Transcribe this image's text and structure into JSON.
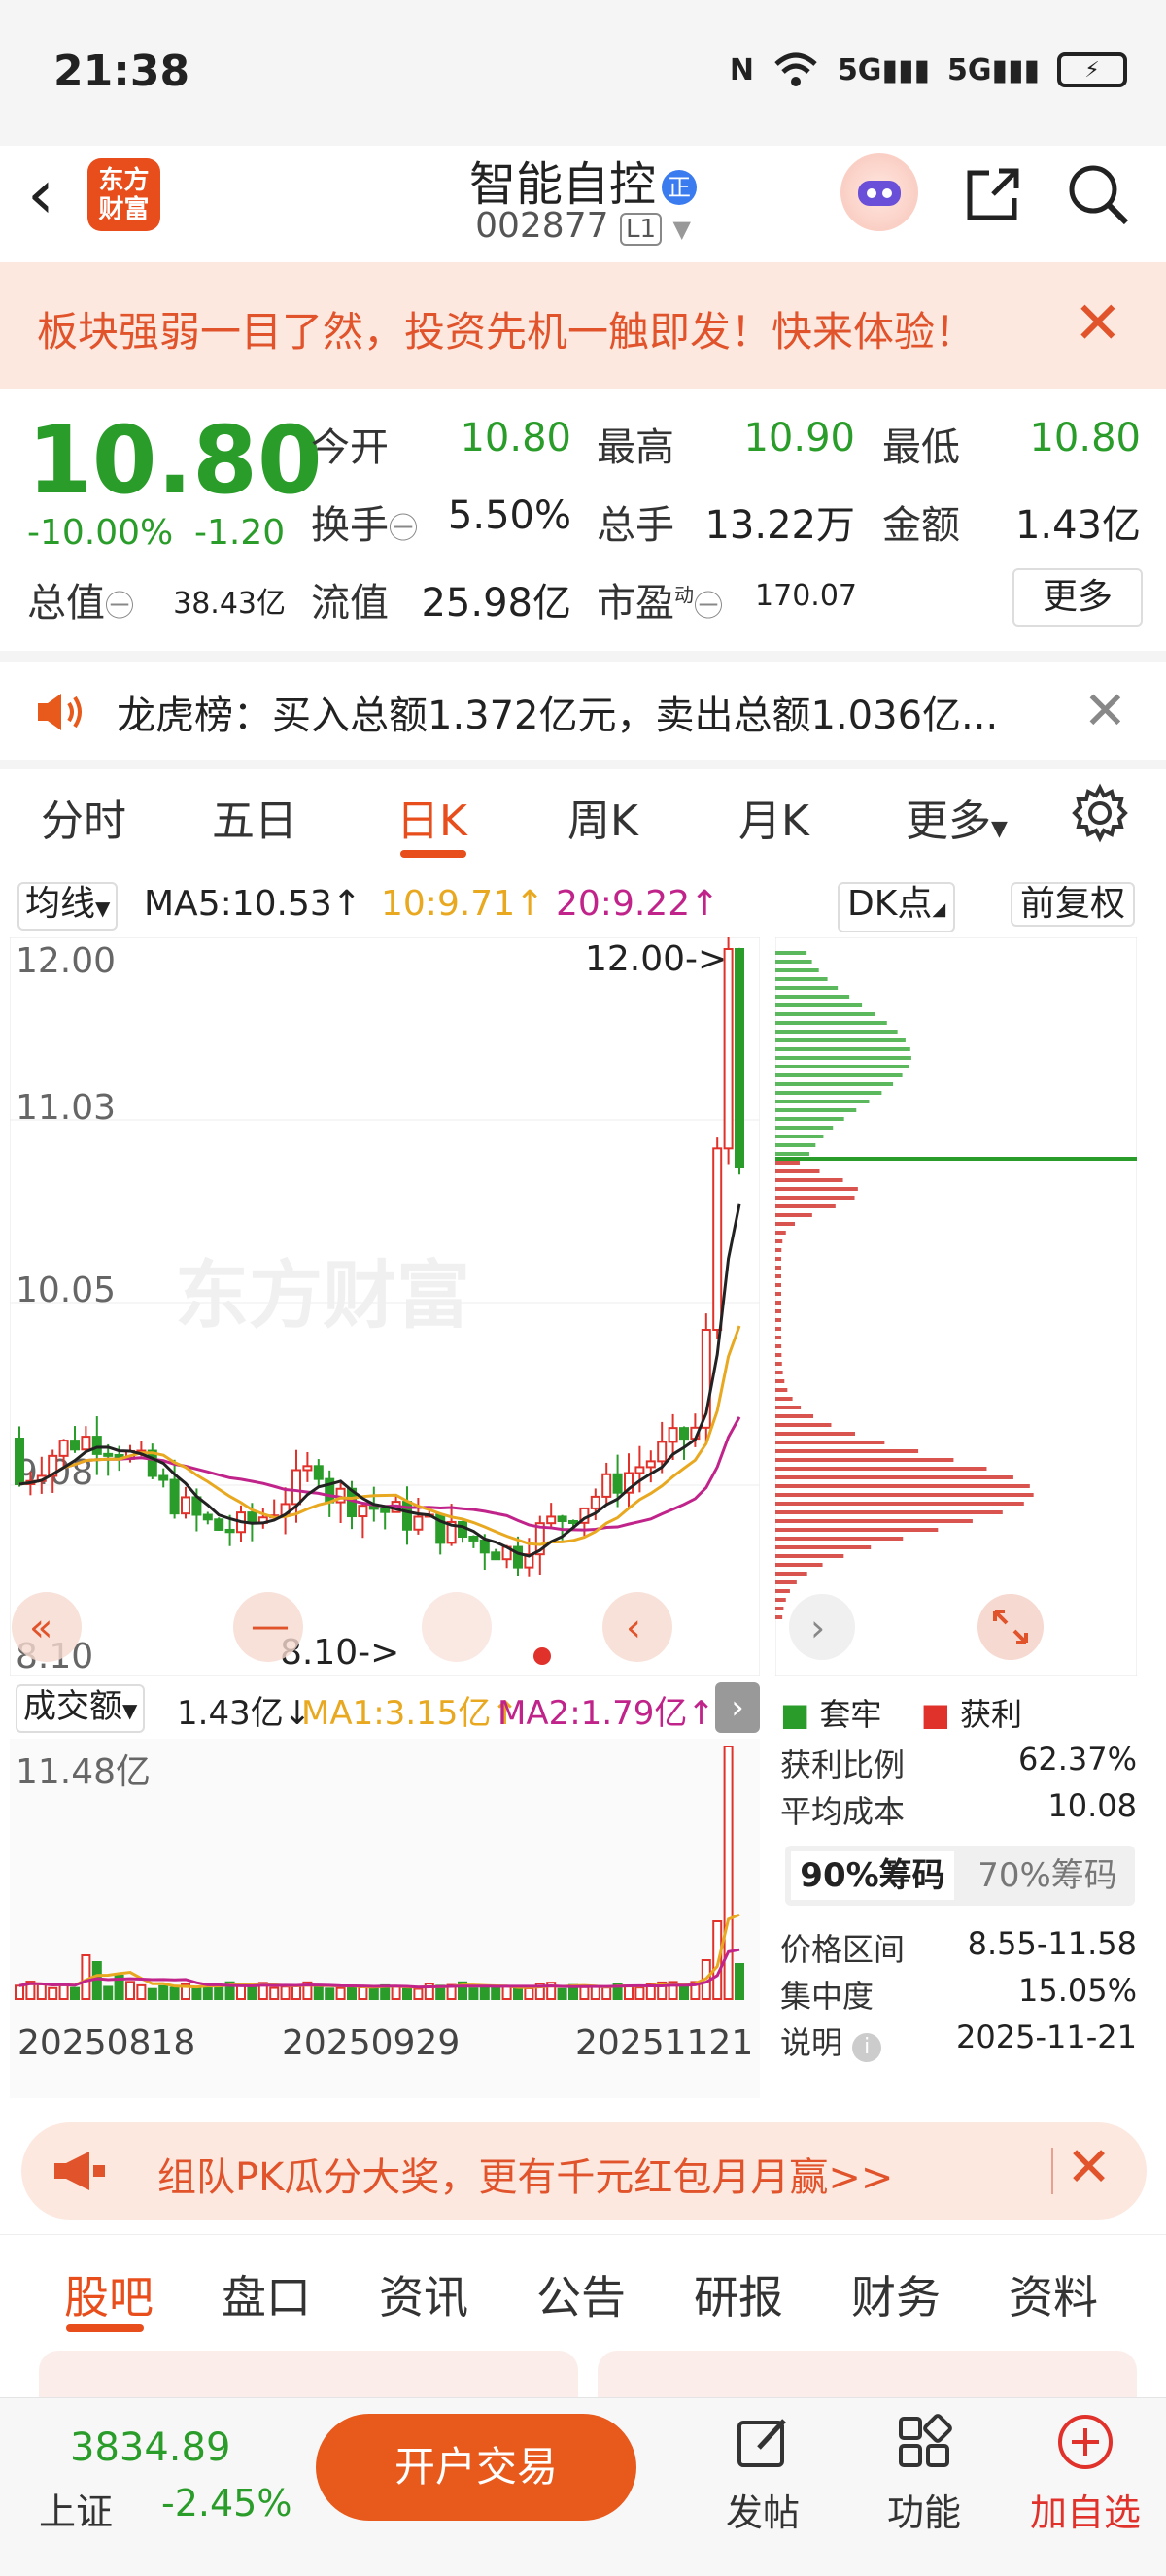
{
  "status_bar": {
    "time": "21:38",
    "nfc": "N",
    "net1": "5G",
    "net2": "5G"
  },
  "header": {
    "logo_line1": "东方",
    "logo_line2": "财富",
    "stock_name": "智能自控",
    "badge": "正",
    "stock_code": "002877",
    "level": "L1"
  },
  "promo": {
    "text": "板块强弱一目了然，投资先机一触即发！快来体验！"
  },
  "quote": {
    "price": "10.80",
    "change_pct": "-10.00%",
    "change_abs": "-1.20",
    "open_label": "今开",
    "open": "10.80",
    "high_label": "最高",
    "high": "10.90",
    "low_label": "最低",
    "low": "10.80",
    "turnover_label": "换手",
    "turnover": "5.50%",
    "volume_label": "总手",
    "volume": "13.22万",
    "amount_label": "金额",
    "amount": "1.43亿",
    "mktcap_label": "总值",
    "mktcap": "38.43亿",
    "float_label": "流值",
    "float": "25.98亿",
    "pe_label": "市盈",
    "pe_sup": "动",
    "pe": "170.07",
    "more": "更多"
  },
  "dragon": {
    "text": "龙虎榜：买入总额1.372亿元，卖出总额1.036亿..."
  },
  "tabs": [
    "分时",
    "五日",
    "日K",
    "周K",
    "月K",
    "更多"
  ],
  "ma_bar": {
    "select": "均线",
    "ma5": "MA5:10.53↑",
    "ma10": "10:9.71↑",
    "ma20": "20:9.22↑",
    "dk": "DK点",
    "adjust": "前复权"
  },
  "kline": {
    "y_labels": [
      "12.00",
      "11.03",
      "10.05",
      "9.08",
      "8.10"
    ],
    "high_marker": "12.00->",
    "low_marker": "8.10->",
    "watermark": "东方财富",
    "colors": {
      "up": "#e0312b",
      "down": "#2a9c2a",
      "ma5": "#222222",
      "ma10": "#e8a820",
      "ma20": "#c0248a"
    }
  },
  "volume": {
    "select": "成交额",
    "current": "1.43亿↓",
    "ma1": "MA1:3.15亿↑",
    "ma2": "MA2:1.79亿↑",
    "y_max": "11.48亿",
    "dates": [
      "20250818",
      "20250929",
      "20251121"
    ]
  },
  "chips": {
    "legend_trapped": "套牢",
    "legend_profit": "获利",
    "profit_ratio_label": "获利比例",
    "profit_ratio": "62.37%",
    "avg_cost_label": "平均成本",
    "avg_cost": "10.08",
    "tab90": "90%筹码",
    "tab70": "70%筹码",
    "range_label": "价格区间",
    "range": "8.55-11.58",
    "conc_label": "集中度",
    "conc": "15.05%",
    "note_label": "说明",
    "note": "2025-11-21"
  },
  "promo2": {
    "text": "组队PK瓜分大奖，更有千元红包月月赢>>"
  },
  "bottom_tabs": [
    "股吧",
    "盘口",
    "资讯",
    "公告",
    "研报",
    "财务",
    "资料"
  ],
  "footer": {
    "index_value": "3834.89",
    "index_name": "上证",
    "index_pct": "-2.45%",
    "open_account": "开户交易",
    "post": "发帖",
    "func": "功能",
    "add": "加自选"
  }
}
